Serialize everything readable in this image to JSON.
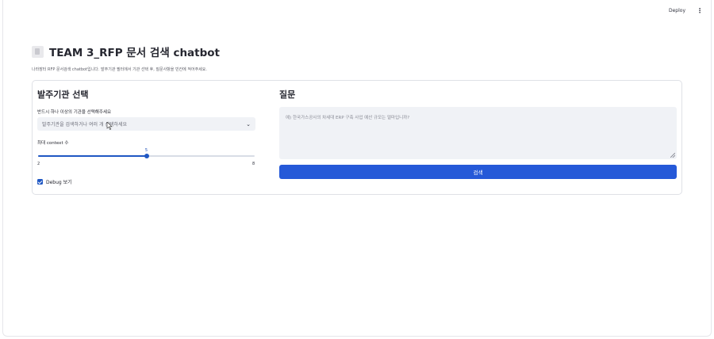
{
  "header": {
    "deploy_label": "Deploy",
    "menu_icon": "more-vertical-icon"
  },
  "page": {
    "title": "TEAM 3_RFP 문서 검색 chatbot",
    "title_icon": "document-icon",
    "subtitle": "나라장터 RFP 문서검색 chatbot입니다. 발주기관 필터에서 기관 선택 후, 질문사항을 빈칸에 적어주세요."
  },
  "left": {
    "heading": "발주기관 선택",
    "select_label": "반드시 하나 이상의 기관을 선택해주세요",
    "select_placeholder": "발주기관을 검색하거나 여러 개 선택하세요",
    "slider": {
      "label": "최대 context 수",
      "min": 2,
      "max": 8,
      "value": 5,
      "min_text": "2",
      "max_text": "8",
      "value_text": "5"
    },
    "debug": {
      "label": "Debug 보기",
      "checked": true
    }
  },
  "right": {
    "heading": "질문",
    "question_placeholder": "예) 한국가스공사의 차세대 ERP 구축 사업 예산 규모는 얼마입니까?",
    "search_label": "검색"
  },
  "colors": {
    "accent": "#2559d8",
    "input_bg": "#f0f2f6"
  }
}
